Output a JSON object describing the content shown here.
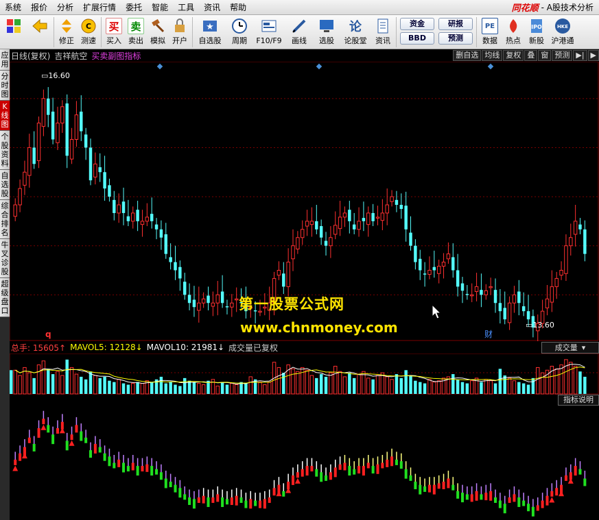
{
  "menu": [
    "系统",
    "报价",
    "分析",
    "扩展行情",
    "委托",
    "智能",
    "工具",
    "资讯",
    "帮助"
  ],
  "brand": {
    "logo": "同花顺",
    "subtitle": "- A股技术分析"
  },
  "toolbar": [
    {
      "label": "",
      "icon": "grid-icon"
    },
    {
      "label": "",
      "icon": "back-arrow-icon"
    },
    {
      "label": "修正",
      "icon": "updown-arrow-icon"
    },
    {
      "label": "测速",
      "icon": "speed-icon"
    },
    {
      "label": "买入",
      "icon": "buy-icon",
      "glyph": "买"
    },
    {
      "label": "卖出",
      "icon": "sell-icon",
      "glyph": "卖"
    },
    {
      "label": "模拟",
      "icon": "gavel-icon"
    },
    {
      "label": "开户",
      "icon": "lock-icon"
    },
    {
      "label": "自选股",
      "icon": "star-icon"
    },
    {
      "label": "周期",
      "icon": "clock-icon"
    },
    {
      "label": "F10/F9",
      "icon": "f10-icon"
    },
    {
      "label": "画线",
      "icon": "pen-icon"
    },
    {
      "label": "选股",
      "icon": "monitor-icon"
    },
    {
      "label": "论股堂",
      "icon": "lun-icon",
      "glyph": "论"
    },
    {
      "label": "资讯",
      "icon": "news-icon"
    }
  ],
  "pills": [
    [
      "资金",
      "BBD"
    ],
    [
      "研报",
      "预测"
    ]
  ],
  "toolbar_right": [
    {
      "label": "数据",
      "icon": "pe-icon",
      "glyph": "PE"
    },
    {
      "label": "热点",
      "icon": "hot-icon"
    },
    {
      "label": "新股",
      "icon": "ipo-icon"
    },
    {
      "label": "沪港通",
      "icon": "hk-icon"
    }
  ],
  "left_tabs": [
    {
      "label": "应用",
      "active": false
    },
    {
      "label": "分时图",
      "active": false
    },
    {
      "label": "K线图",
      "active": true
    },
    {
      "label": "个股资料",
      "active": false
    },
    {
      "label": "自选股",
      "active": false
    },
    {
      "label": "综合排名",
      "active": false
    },
    {
      "label": "牛叉诊股",
      "active": false
    },
    {
      "label": "超级盘口",
      "active": false
    }
  ],
  "chart_header": {
    "period": "日线(复权)",
    "stock": "吉祥航空",
    "indicator": "买卖副图指标"
  },
  "chart_tools": [
    "删自选",
    "均线",
    "复权",
    "叠",
    "窗",
    "预测",
    "▶|",
    "▶"
  ],
  "price_labels": {
    "high": "16.60",
    "low": "13.60"
  },
  "markers": {
    "q": "q",
    "cai": "财"
  },
  "watermark": {
    "line1": "第一股票公式网",
    "line2": "www.chnmoney.com"
  },
  "volume_legend": {
    "total": "总手: 15605↑",
    "mavol5": "MAVOL5: 12128↓",
    "mavol10": "MAVOL10: 21981↓",
    "note": "成交量已复权",
    "dropdown": "成交量"
  },
  "indicator_button": "指标说明",
  "colors": {
    "up": "#ff3030",
    "down": "#54fcfc",
    "grid": "#7a0000",
    "accent": "#c00"
  }
}
